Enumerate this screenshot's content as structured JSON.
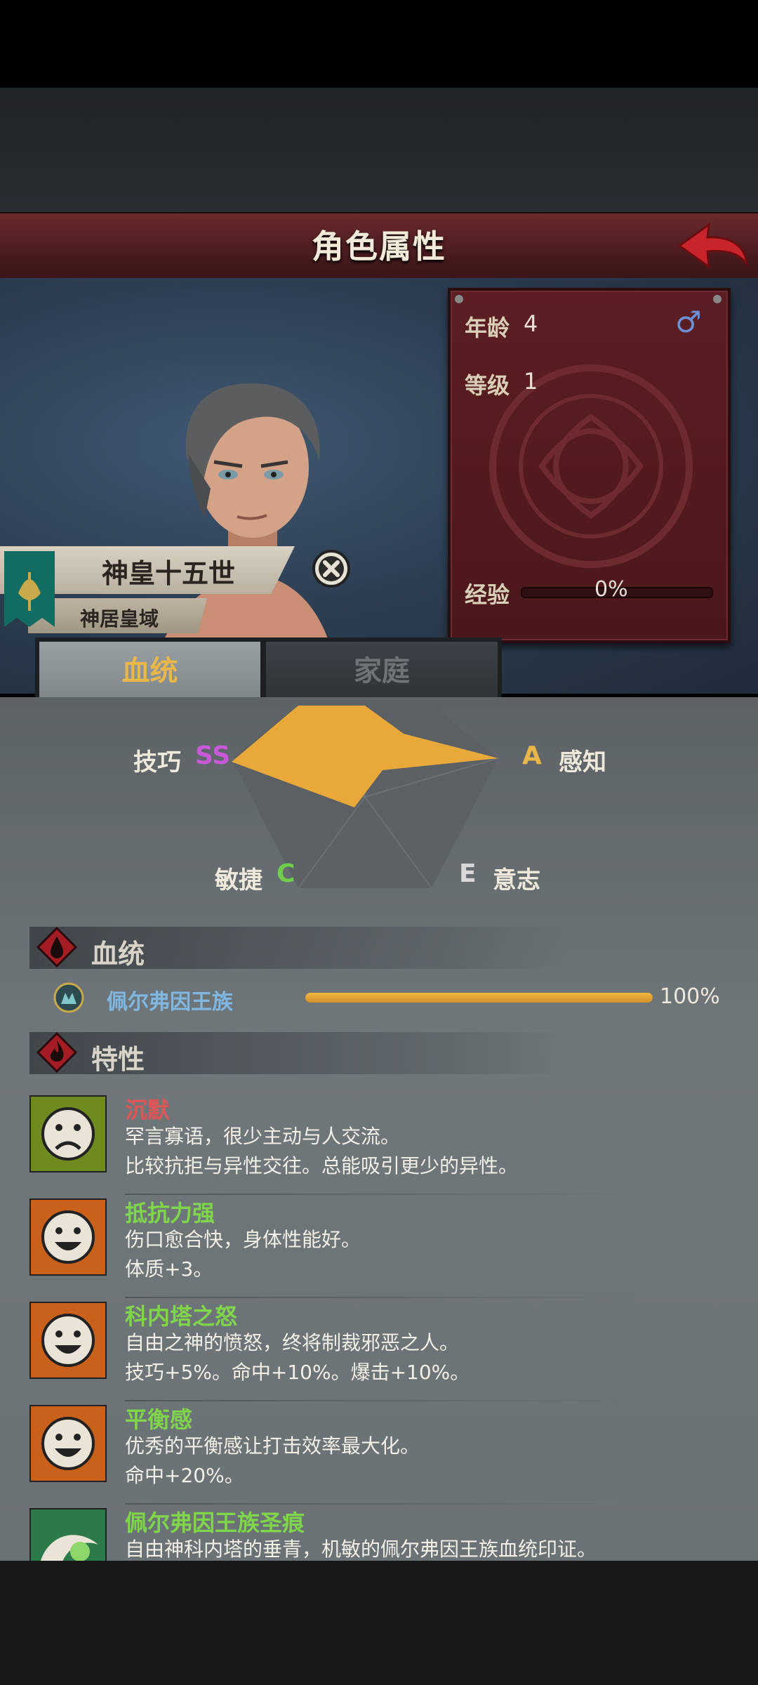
{
  "title": "角色属性",
  "character": {
    "name": "神皇十五世",
    "region": "神居皇域",
    "age_label": "年龄",
    "age_value": "4",
    "level_label": "等级",
    "level_value": "1",
    "exp_label": "经验",
    "exp_value": "0%",
    "exp_fraction": 0,
    "gender": "male"
  },
  "tabs": [
    {
      "label": "血统",
      "active": true
    },
    {
      "label": "家庭",
      "active": false
    }
  ],
  "stats": {
    "skill_label": "技巧",
    "skill_grade": "SS",
    "perception_label": "感知",
    "perception_grade": "A",
    "agility_label": "敏捷",
    "agility_grade": "C",
    "will_label": "意志",
    "will_grade": "E"
  },
  "bloodline_section": {
    "title": "血统",
    "name": "佩尔弗因王族",
    "percent": "100%",
    "fraction": 1.0
  },
  "traits_section": {
    "title": "特性",
    "items": [
      {
        "name": "沉默",
        "line1": "罕言寡语，很少主动与人交流。",
        "line2": "比较抗拒与异性交往。总能吸引更少的异性。",
        "color": "#e05555",
        "face": "sad"
      },
      {
        "name": "抵抗力强",
        "line1": "伤口愈合快，身体性能好。",
        "line2": "体质+3。",
        "color": "#7fd64b",
        "face": "happy"
      },
      {
        "name": "科内塔之怒",
        "line1": "自由之神的愤怒，终将制裁邪恶之人。",
        "line2": "技巧+5%。命中+10%。爆击+10%。",
        "color": "#7fd64b",
        "face": "happy"
      },
      {
        "name": "平衡感",
        "line1": "优秀的平衡感让打击效率最大化。",
        "line2": "命中+20%。",
        "color": "#7fd64b",
        "face": "happy"
      },
      {
        "name": "佩尔弗因王族圣痕",
        "line1": "自由神科内塔的垂青，机敏的佩尔弗因王族血统印证。",
        "line2": "",
        "color": "#7fd64b",
        "face": "mark"
      }
    ]
  },
  "colors": {
    "accent_gold": "#e9b64a",
    "grade_ss": "#c85ad8",
    "grade_a": "#e9b64a",
    "grade_c": "#6fce4b",
    "grade_e": "#d8d8d8",
    "radar_fill": "#e8a93a"
  }
}
